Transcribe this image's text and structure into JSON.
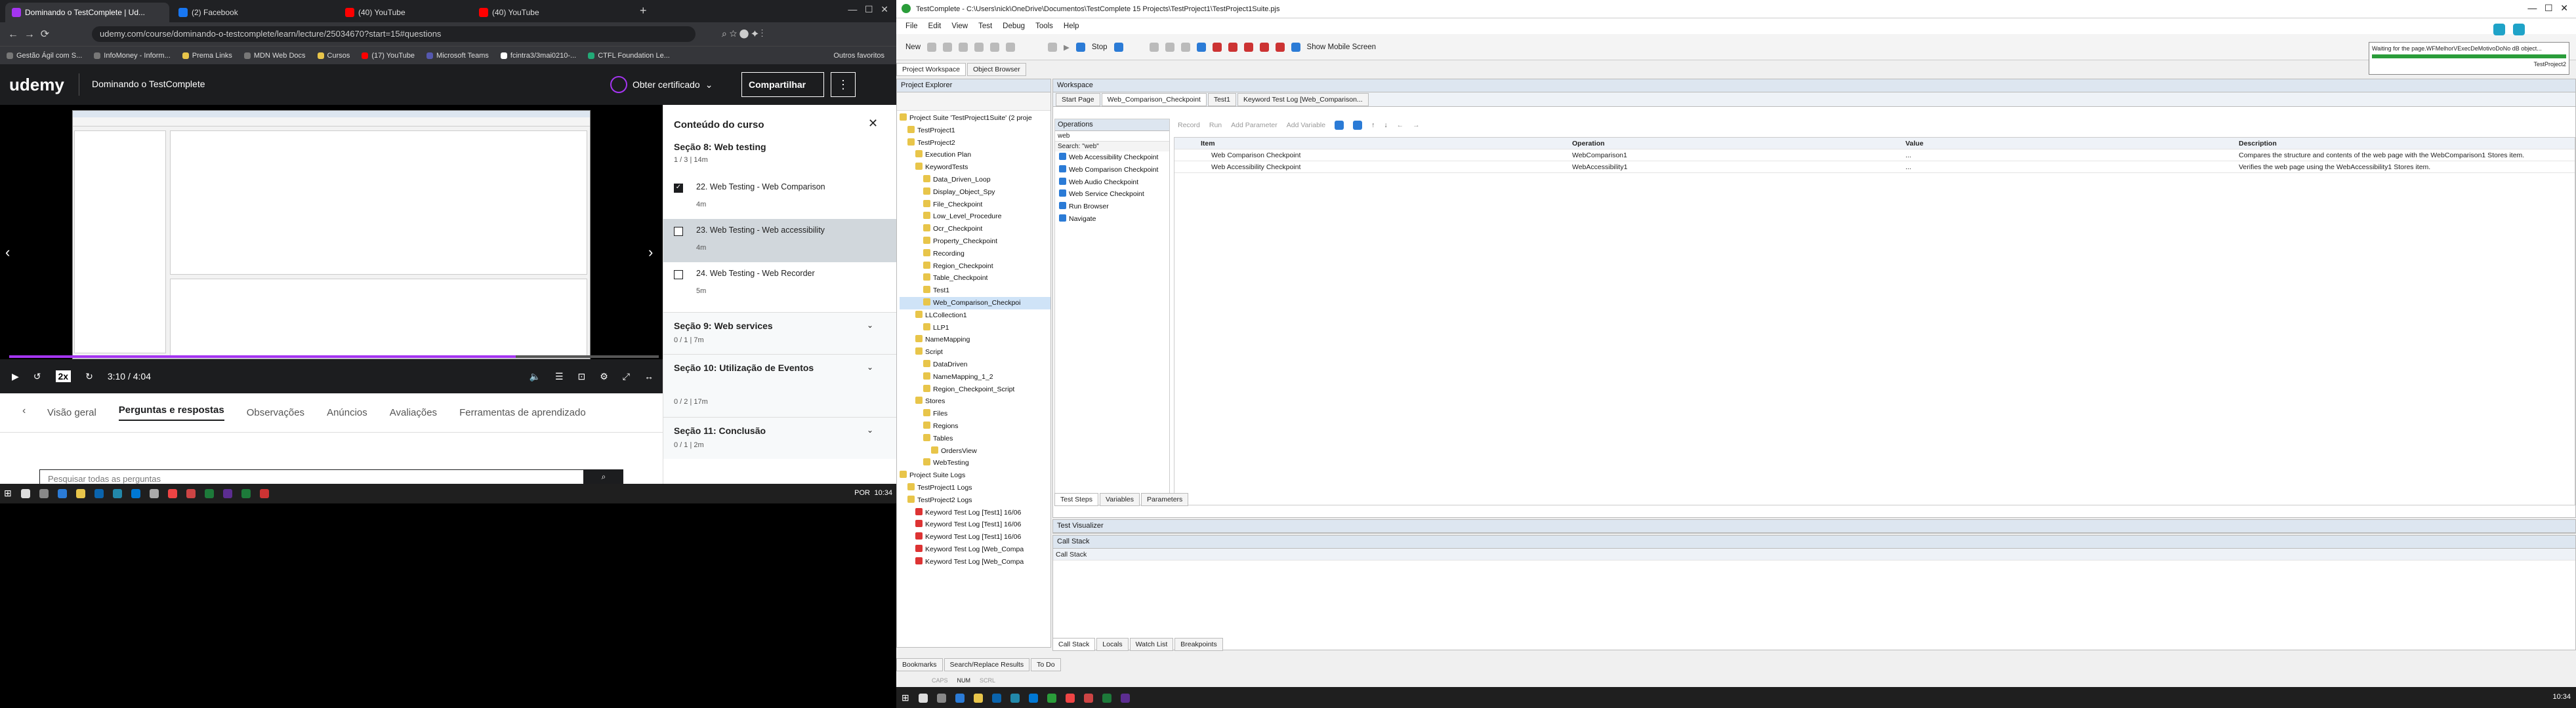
{
  "browser": {
    "tabs": [
      "Dominando o TestComplete | Ud...",
      "(2) Facebook",
      "(40) YouTube",
      "(40) YouTube"
    ],
    "url": "udemy.com/course/dominando-o-testcomplete/learn/lecture/25034670?start=15#questions",
    "bookmarks": [
      "Gestão Ágil com S...",
      "InfoMoney - Inform...",
      "Prema Links",
      "MDN Web Docs",
      "Cursos",
      "(17) YouTube",
      "Microsoft Teams",
      "fcintra3/3mai0210-...",
      "CTFL Foundation Le...",
      "Outros favoritos"
    ]
  },
  "udemy": {
    "logo": "udemy",
    "course_title": "Dominando o TestComplete",
    "cert": "Obter certificado",
    "share": "Compartilhar",
    "video": {
      "time": "3:10 / 4:04",
      "speed": "2x"
    },
    "panel_title": "Conteúdo do curso",
    "section8": {
      "title": "Seção 8: Web testing",
      "meta": "1 / 3 | 14m"
    },
    "lectures": [
      {
        "title": "22. Web Testing - Web Comparison",
        "dur": "4m",
        "checked": true
      },
      {
        "title": "23. Web Testing - Web accessibility",
        "dur": "4m",
        "checked": false
      },
      {
        "title": "24. Web Testing - Web Recorder",
        "dur": "5m",
        "checked": false
      }
    ],
    "sections": [
      {
        "title": "Seção 9: Web services",
        "meta": "0 / 1 | 7m"
      },
      {
        "title": "Seção 10: Utilização de Eventos",
        "meta": "0 / 2 | 17m"
      },
      {
        "title": "Seção 11: Conclusão",
        "meta": "0 / 1 | 2m"
      }
    ],
    "tabs": [
      "Visão geral",
      "Perguntas e respostas",
      "Observações",
      "Anúncios",
      "Avaliações",
      "Ferramentas de aprendizado"
    ],
    "search_placeholder": "Pesquisar todas as perguntas"
  },
  "taskbar_left": {
    "lang": "POR",
    "time": "10:34"
  },
  "testcomplete": {
    "title": "TestComplete - C:\\Users\\nick\\OneDrive\\Documentos\\TestComplete 15 Projects\\TestProject1\\TestProject1Suite.pjs",
    "menu": [
      "File",
      "Edit",
      "View",
      "Test",
      "Debug",
      "Tools",
      "Help"
    ],
    "toolbar": {
      "new": "New",
      "stop": "Stop",
      "mobile": "Show Mobile Screen"
    },
    "notice": {
      "line1": "Waiting for the page.WFMelhorVExecDeMotivoDoNo dB object...",
      "line2": "TestProject2"
    },
    "ws_tabs": [
      "Project Workspace",
      "Object Browser"
    ],
    "explorer_title": "Project Explorer",
    "tree": [
      "Project Suite 'TestProject1Suite' (2 proje",
      "TestProject1",
      "TestProject2",
      "Execution Plan",
      "KeywordTests",
      "Data_Driven_Loop",
      "Display_Object_Spy",
      "File_Checkpoint",
      "Low_Level_Procedure",
      "Ocr_Checkpoint",
      "Property_Checkpoint",
      "Recording",
      "Region_Checkpoint",
      "Table_Checkpoint",
      "Test1",
      "Web_Comparison_Checkpoi",
      "LLCollection1",
      "LLP1",
      "NameMapping",
      "Script",
      "DataDriven",
      "NameMapping_1_2",
      "Region_Checkpoint_Script",
      "Stores",
      "Files",
      "Regions",
      "Tables",
      "OrdersView",
      "WebTesting",
      "Project Suite Logs",
      "TestProject1 Logs",
      "TestProject2 Logs",
      "Keyword Test Log [Test1] 16/06",
      "Keyword Test Log [Test1] 16/06",
      "Keyword Test Log [Test1] 16/06",
      "Keyword Test Log [Web_Compa",
      "Keyword Test Log [Web_Compa"
    ],
    "workspace_title": "Workspace",
    "doc_tabs": [
      "Start Page",
      "Web_Comparison_Checkpoint",
      "Test1",
      "Keyword Test Log [Web_Comparison..."
    ],
    "kt_toolbar": [
      "Record",
      "Run",
      "Add Parameter",
      "Add Variable"
    ],
    "operations_title": "Operations",
    "ops_search": "Search: \"web\"",
    "ops_filter": "web",
    "operations": [
      "Web Accessibility Checkpoint",
      "Web Comparison Checkpoint",
      "Web Audio Checkpoint",
      "Web Service Checkpoint",
      "Run Browser",
      "Navigate"
    ],
    "grid_headers": [
      "Item",
      "Operation",
      "Value",
      "Description"
    ],
    "grid_rows": [
      {
        "item": "Web Comparison Checkpoint",
        "op": "WebComparison1",
        "val": "...",
        "desc": "Compares the structure and contents of the web page with the WebComparison1 Stores item."
      },
      {
        "item": "Web Accessibility Checkpoint",
        "op": "WebAccessibility1",
        "val": "...",
        "desc": "Verifies the web page using the WebAccessibility1 Stores item."
      }
    ],
    "bottom_tabs": [
      "Test Steps",
      "Variables",
      "Parameters"
    ],
    "visualizer": "Test Visualizer",
    "callstack_title": "Call Stack",
    "callstack_header": "Call Stack",
    "debug_tabs": [
      "Call Stack",
      "Locals",
      "Watch List",
      "Breakpoints"
    ],
    "status_tabs": [
      "Bookmarks",
      "Search/Replace Results",
      "To Do"
    ],
    "status_indicators": [
      "CAPS",
      "NUM",
      "SCRL"
    ],
    "time": "10:34"
  }
}
